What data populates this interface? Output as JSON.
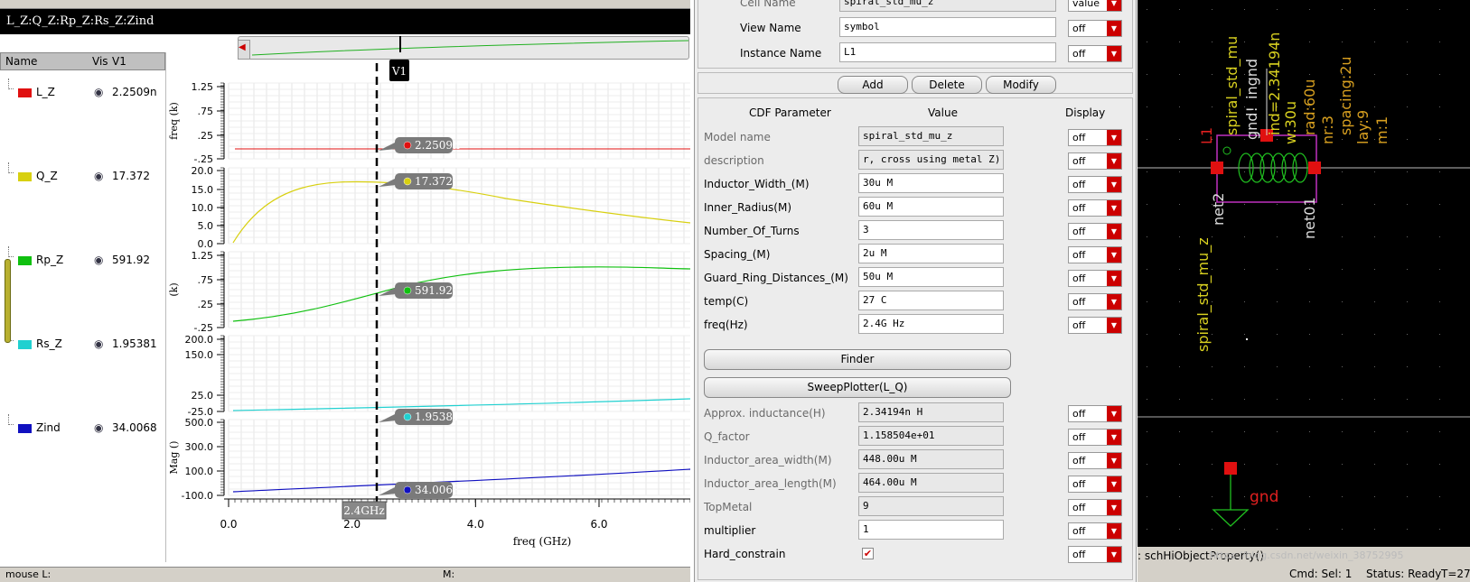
{
  "wave": {
    "title": "L_Z:Q_Z:Rp_Z:Rs_Z:Zind",
    "legend_headers": {
      "name": "Name",
      "vis": "Vis",
      "v1": "V1"
    },
    "signals": [
      {
        "name": "L_Z",
        "color": "#e01010",
        "value": "2.2509n"
      },
      {
        "name": "Q_Z",
        "color": "#d8d010",
        "value": "17.372"
      },
      {
        "name": "Rp_Z",
        "color": "#10c010",
        "value": "591.92"
      },
      {
        "name": "Rs_Z",
        "color": "#20d0d0",
        "value": "1.95381"
      },
      {
        "name": "Zind",
        "color": "#1010c0",
        "value": "34.0068"
      }
    ],
    "marker_label": "V1",
    "marker_x_label": "2.4GHz",
    "xaxis_label": "freq (GHz)",
    "xticks": [
      "0.0",
      "2.0",
      "4.0",
      "6.0"
    ],
    "strips": [
      {
        "ylabel": "freq (k)",
        "ticks": [
          "1.25",
          ".75",
          ".25",
          "-.25"
        ]
      },
      {
        "ylabel": "",
        "ticks": [
          "20.0",
          "15.0",
          "10.0",
          "5.0",
          "0.0"
        ]
      },
      {
        "ylabel": "(k)",
        "ticks": [
          "1.25",
          ".75",
          ".25",
          "-.25"
        ]
      },
      {
        "ylabel": "",
        "ticks": [
          "200.0",
          "150.0",
          "25.0",
          "-25.0"
        ]
      },
      {
        "ylabel": "Mag ()",
        "ticks": [
          "500.0",
          "300.0",
          "100.0",
          "-100.0"
        ]
      }
    ],
    "status_left": "mouse L:",
    "status_mid": "M:"
  },
  "form": {
    "top_rows": [
      {
        "label": "Cell Name",
        "value": "spiral_std_mu_z",
        "display": "value"
      },
      {
        "label": "View Name",
        "value": "symbol",
        "display": "off"
      },
      {
        "label": "Instance Name",
        "value": "L1",
        "display": "off"
      }
    ],
    "buttons": {
      "add": "Add",
      "delete": "Delete",
      "modify": "Modify",
      "finder": "Finder",
      "sweep": "SweepPlotter(L_Q)"
    },
    "headers": {
      "param": "CDF Parameter",
      "value": "Value",
      "display": "Display"
    },
    "params": [
      {
        "label": "Model name",
        "value": "spiral_std_mu_z",
        "grey": true,
        "ro": true,
        "display": "off"
      },
      {
        "label": "description",
        "value": "r, cross using metal Z)",
        "grey": true,
        "ro": true,
        "display": "off"
      },
      {
        "label": "Inductor_Width_(M)",
        "value": "30u M",
        "grey": false,
        "ro": false,
        "display": "off"
      },
      {
        "label": "Inner_Radius(M)",
        "value": "60u M",
        "grey": false,
        "ro": false,
        "display": "off"
      },
      {
        "label": "Number_Of_Turns",
        "value": "3",
        "grey": false,
        "ro": false,
        "display": "off"
      },
      {
        "label": "Spacing_(M)",
        "value": "2u M",
        "grey": false,
        "ro": false,
        "display": "off"
      },
      {
        "label": "Guard_Ring_Distances_(M)",
        "value": "50u M",
        "grey": false,
        "ro": false,
        "display": "off"
      },
      {
        "label": "temp(C)",
        "value": "27 C",
        "grey": false,
        "ro": false,
        "display": "off"
      },
      {
        "label": "freq(Hz)",
        "value": "2.4G Hz",
        "grey": false,
        "ro": false,
        "display": "off"
      }
    ],
    "results": [
      {
        "label": "Approx. inductance(H)",
        "value": "2.34194n H",
        "grey": true,
        "ro": true,
        "display": "off"
      },
      {
        "label": "Q_factor",
        "value": "1.158504e+01",
        "grey": true,
        "ro": true,
        "display": "off"
      },
      {
        "label": "Inductor_area_width(M)",
        "value": "448.00u M",
        "grey": true,
        "ro": true,
        "display": "off"
      },
      {
        "label": "Inductor_area_length(M)",
        "value": "464.00u M",
        "grey": true,
        "ro": true,
        "display": "off"
      },
      {
        "label": "TopMetal",
        "value": "9",
        "grey": true,
        "ro": true,
        "display": "off"
      },
      {
        "label": "multiplier",
        "value": "1",
        "grey": false,
        "ro": false,
        "display": "off"
      },
      {
        "label": "Hard_constrain",
        "value": "",
        "grey": false,
        "ro": false,
        "display": "off",
        "checkbox": true
      }
    ]
  },
  "schem": {
    "rot_labels": [
      "spiral_std_mu_z",
      "net2",
      "L1",
      "spiral_std_mu",
      "gnd!",
      "ind=2.34194n",
      "ingnd",
      "w:30u",
      "rad:60u",
      "nr:3",
      "spacing:2u",
      "lay:9",
      "m:1",
      "net01"
    ],
    "gnd_label": "gnd",
    "status": {
      "cmd_prefix": ": schHiObjectProperty()",
      "cmd": "Cmd: Sel: 1",
      "status": "Status: Ready",
      "t": "T=27",
      "watermark": "https://blog.csdn.net/weixin_38752995"
    }
  }
}
